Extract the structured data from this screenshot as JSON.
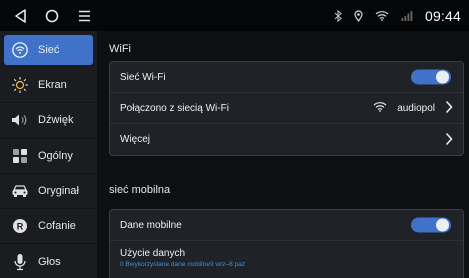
{
  "statusbar": {
    "icons": [
      "back-icon",
      "home-icon",
      "menu-icon",
      "bluetooth-icon",
      "location-icon",
      "wifi-icon",
      "signal-icon"
    ],
    "time": "09:44"
  },
  "sidebar": {
    "items": [
      {
        "label": "Sieć",
        "icon": "wifi-settings-icon",
        "active": true
      },
      {
        "label": "Ekran",
        "icon": "brightness-icon"
      },
      {
        "label": "Dźwięk",
        "icon": "speaker-icon"
      },
      {
        "label": "Ogólny",
        "icon": "grid-icon"
      },
      {
        "label": "Oryginał",
        "icon": "car-icon"
      },
      {
        "label": "Cofanie",
        "icon": "reverse-icon"
      },
      {
        "label": "Głos",
        "icon": "microphone-icon"
      }
    ]
  },
  "wifi": {
    "section_title": "WiFi",
    "toggle_label": "Sieć Wi-Fi",
    "connected_label": "Połączono z siecią Wi-Fi",
    "connected_network": "audiopol",
    "more_label": "Więcej"
  },
  "mobile": {
    "section_title": "sieć mobilna",
    "data_label": "Dane mobilne",
    "usage_label": "Użycie danych",
    "usage_sub": "0 Bwykorzystane dane mobilne9 wrz–8 paź"
  },
  "colors": {
    "accent": "#3f72c8",
    "link": "#3f8fe0",
    "background": "#0d0f12",
    "card": "#1f2226"
  }
}
